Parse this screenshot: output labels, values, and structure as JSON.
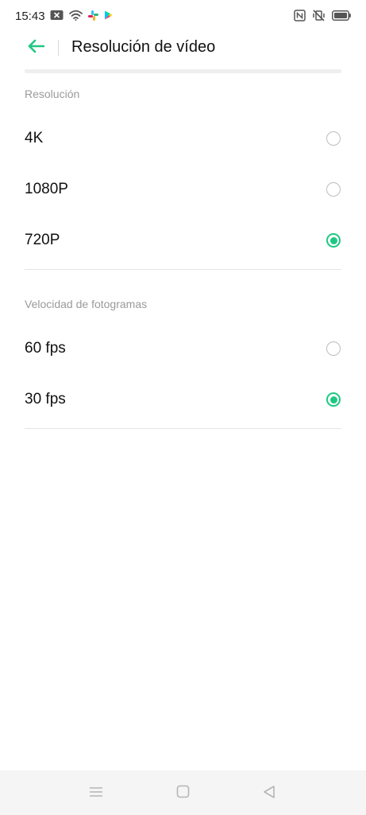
{
  "status_bar": {
    "time": "15:43",
    "left_icons": [
      "close-notification-icon",
      "wifi-icon",
      "slack-icon",
      "play-store-icon"
    ],
    "right_icons": [
      "nfc-icon",
      "vibrate-off-icon",
      "battery-icon"
    ]
  },
  "header": {
    "title": "Resolución de vídeo",
    "back_icon": "back-arrow-icon"
  },
  "resolution_section": {
    "label": "Resolución",
    "options": [
      {
        "label": "4K",
        "selected": false
      },
      {
        "label": "1080P",
        "selected": false
      },
      {
        "label": "720P",
        "selected": true
      }
    ]
  },
  "framerate_section": {
    "label": "Velocidad de fotogramas",
    "options": [
      {
        "label": "60 fps",
        "selected": false
      },
      {
        "label": "30 fps",
        "selected": true
      }
    ]
  },
  "nav_bar": {
    "icons": [
      "menu-icon",
      "home-icon",
      "back-icon"
    ]
  },
  "colors": {
    "accent": "#1ec882",
    "radio_unchecked": "#bdbdbd",
    "section_label": "#9a9a9a",
    "divider": "#e4e4e4",
    "nav_background": "#f5f5f5"
  }
}
